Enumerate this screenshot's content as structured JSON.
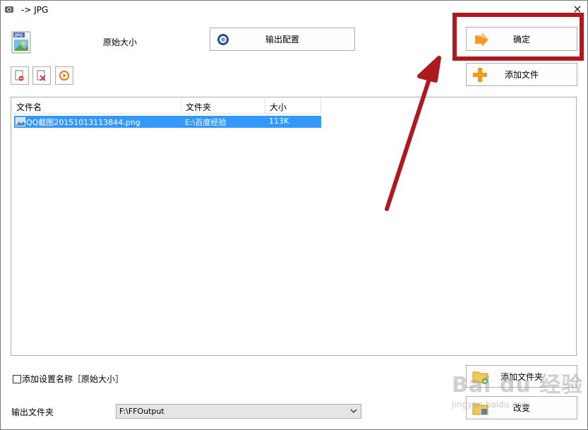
{
  "window": {
    "title": "-> JPG",
    "close_glyph": "×"
  },
  "top": {
    "preset_label": "原始大小",
    "output_config_label": "输出配置",
    "ok_label": "确定",
    "add_file_label": "添加文件"
  },
  "toolbar": {
    "icons": [
      "remove-file-icon",
      "clear-list-icon",
      "play-icon"
    ]
  },
  "file_list": {
    "columns": [
      "文件名",
      "文件夹",
      "大小"
    ],
    "rows": [
      {
        "name": "QQ截图20151013113844.png",
        "folder": "E:\\百度经验",
        "size": "113K"
      }
    ]
  },
  "bottom": {
    "checkbox_label": "添加设置名称［原始大小］",
    "output_folder_label": "输出文件夹",
    "output_folder_value": "F:\\FFOutput",
    "add_folder_label": "添加文件夹",
    "change_label": "改变"
  },
  "watermark": {
    "text": "Bai du 经验",
    "sub": "jingyan.baidu.com"
  },
  "colors": {
    "selection": "#3399ff",
    "annotation": "#b0181f"
  }
}
